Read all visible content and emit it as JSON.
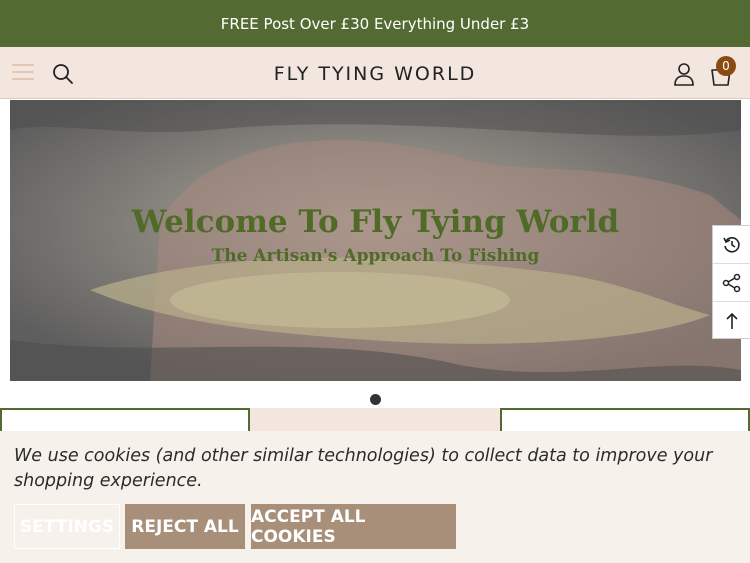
{
  "announcement": "FREE Post Over £30 Everything Under £3",
  "header": {
    "brand": "FLY TYING WORLD",
    "cart_count": "0",
    "icons": {
      "menu": "hamburger-icon",
      "search": "search-icon",
      "account": "user-icon",
      "cart": "shopping-bag-icon"
    }
  },
  "hero": {
    "title": "Welcome To Fly Tying World",
    "subtitle": "The Artisan's Approach To Fishing"
  },
  "side_tools": [
    "history-icon",
    "share-icon",
    "arrow-up-icon"
  ],
  "cookie": {
    "message": "We use cookies (and other similar technologies) to collect data to improve your shopping experience.",
    "settings_label": "SETTINGS",
    "reject_label": "REJECT ALL",
    "accept_label": "ACCEPT ALL COOKIES"
  },
  "colors": {
    "brand_green": "#536b33",
    "header_bg": "#f2e6df",
    "cart_badge": "#8a4b13",
    "cookie_button": "#a88f7a"
  }
}
